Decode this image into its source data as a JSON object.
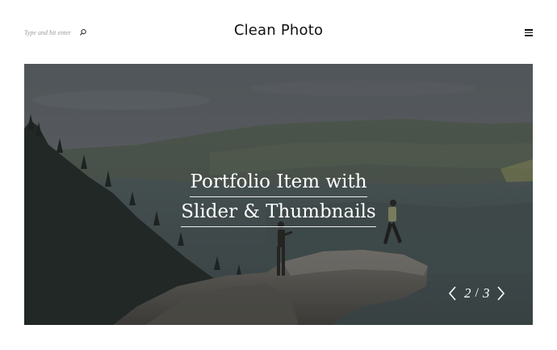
{
  "header": {
    "search_placeholder": "Type and hit enter",
    "title": "Clean Photo",
    "menu_icon": "hamburger-icon",
    "search_icon": "search-icon"
  },
  "hero": {
    "title_line1": "Portfolio Item with",
    "title_line2": "Slider & Thumbnails",
    "slider": {
      "current": "2",
      "separator": "/",
      "total": "3",
      "prev_icon": "chevron-left-icon",
      "next_icon": "chevron-right-icon"
    }
  }
}
